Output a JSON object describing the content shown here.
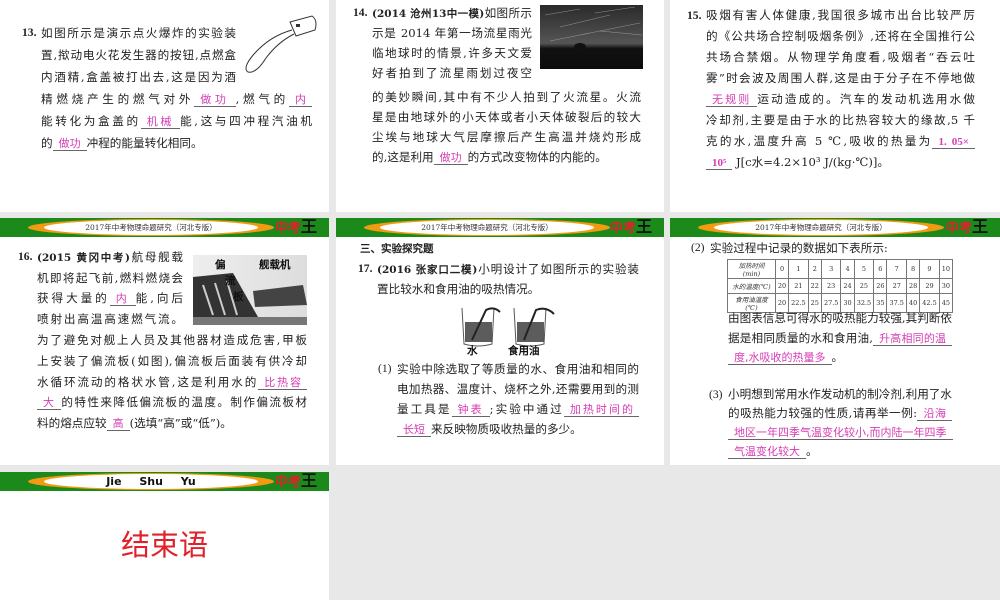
{
  "header": {
    "text": "2017年中考物理命题研究（河北专版）",
    "logo": "中考王"
  },
  "colors": {
    "answer": "#d63cb4",
    "band_green": "#1b8a1b",
    "band_orange": "#f39a12",
    "title_red": "#e0202a"
  },
  "slides": [
    {
      "id": "q13",
      "blocks": [
        [
          [
            {
              "n": "13."
            },
            "如图所示是演示点火爆炸的实验装"
          ],
          [
            "置,揿动电火花发生器的按钮,点燃盒"
          ],
          [
            "内酒精,盒盖被打出去,这是因为酒"
          ],
          [
            "精燃烧产生的燃气对外",
            {
              "a": "做功"
            },
            ",燃气的",
            {
              "a": "内"
            }
          ],
          [
            "能转化为盒盖的",
            {
              "a": "机械"
            },
            "能,这与四冲程汽油机"
          ],
          [
            "的",
            {
              "a": "做功"
            },
            "冲程的能量转化相同。"
          ]
        ]
      ]
    },
    {
      "id": "q14",
      "blocks": [
        [
          [
            {
              "n": "14."
            },
            {
              "b": "(2014 沧州13中一模)"
            },
            "如图所示"
          ],
          [
            "示是 2014 年第一场流星雨光"
          ],
          [
            "临地球时的情景,许多天文爱"
          ],
          [
            "好者拍到了流星雨划过夜空"
          ],
          [
            "的美妙瞬间,其中有不少人拍到了火流星。火流"
          ],
          [
            "星是由地球外的小天体或者小天体破裂后的较大"
          ],
          [
            "尘埃与地球大气层摩擦后产生高温并烧灼形成"
          ],
          [
            "的,这是利用",
            {
              "a": "做功"
            },
            "的方式改变物体的内能的。"
          ]
        ]
      ]
    },
    {
      "id": "q15",
      "blocks": [
        [
          [
            {
              "n": "15."
            },
            "吸烟有害人体健康,我国很多城市出台比较严厉"
          ],
          [
            "的《公共场合控制吸烟条例》,还将在全国推行公"
          ],
          [
            "共场合禁烟。从物理学角度看,吸烟者“吞云吐"
          ],
          [
            "雾”时会波及周围人群,这是由于分子在不停地做"
          ],
          [
            {
              "a": "无规则"
            },
            "运动造成的。汽车的发动机选用水做"
          ],
          [
            "冷却剂,主要是由于水的比热容较大的缘故,5 千"
          ],
          [
            "克的水,温度升高 5 ℃,吸收的热量为",
            {
              "ab": "1. 05×"
            }
          ],
          [
            {
              "ab": "10⁵"
            },
            " J[c水=4.2×10³ J/(kg·℃)]。"
          ]
        ]
      ]
    },
    {
      "id": "q16",
      "image_labels": [
        "偏",
        "流",
        "板",
        "舰载机"
      ],
      "blocks": [
        [
          [
            {
              "n": "16."
            },
            {
              "b": "(2015 黄冈中考)"
            },
            "航母舰载"
          ],
          [
            "机即将起飞前,燃料燃烧会"
          ],
          [
            "获得大量的",
            {
              "a": "内"
            },
            "能,向后"
          ],
          [
            "喷射出高温高速燃气流。"
          ],
          [
            "为了避免对舰上人员及其他器材造成危害,甲板"
          ],
          [
            "上安装了偏流板(如图),偏流板后面装有供冷却"
          ],
          [
            "水循环流动的格状水管,这是利用水的",
            {
              "a": "比热容"
            }
          ],
          [
            {
              "a": "大"
            },
            "的特性来降低偏流板的温度。制作偏流板材"
          ],
          [
            "料的熔点应较",
            {
              "a": "高"
            },
            "(选填“高”或“低”)。"
          ]
        ]
      ]
    },
    {
      "id": "q17",
      "image_labels": [
        "水",
        "食用油"
      ],
      "blocks": [
        [
          [
            {
              "b": "三、实验探究题"
            }
          ]
        ],
        [
          [
            {
              "n": "17."
            },
            {
              "b": "(2016 张家口二模)"
            },
            "小明设计了如图所示的实验装"
          ],
          [
            "置比较水和食用油的吸热情况。"
          ]
        ],
        [
          [
            {
              "p": "(1)"
            },
            "实验中除选取了等质量的水、食用油和相同的"
          ],
          [
            "电加热器、温度计、烧杯之外,还需要用到的测"
          ],
          [
            "量工具是",
            {
              "a": "钟表"
            },
            ";实验中通过",
            {
              "a": "加热时间的"
            }
          ],
          [
            {
              "a": "长短"
            },
            "来反映物质吸收热量的多少。"
          ]
        ]
      ]
    },
    {
      "id": "q17b",
      "table": {
        "rows": [
          {
            "label": "加热时间(min)",
            "values": [
              "0",
              "1",
              "2",
              "3",
              "4",
              "5",
              "6",
              "7",
              "8",
              "9",
              "10"
            ]
          },
          {
            "label": "水的温度(℃)",
            "values": [
              "20",
              "21",
              "22",
              "23",
              "24",
              "25",
              "26",
              "27",
              "28",
              "29",
              "30"
            ]
          },
          {
            "label": "食用油温度(℃)",
            "values": [
              "20",
              "22.5",
              "25",
              "27.5",
              "30",
              "32.5",
              "35",
              "37.5",
              "40",
              "42.5",
              "45"
            ]
          }
        ]
      },
      "blocks": [
        [
          [
            {
              "p": "(2)"
            },
            "实验过程中记录的数据如下表所示:"
          ]
        ],
        [
          [
            "由图表信息可得水的吸热能力较强,其判断依"
          ],
          [
            "据是相同质量的水和食用油,",
            {
              "a": "升高相同的温"
            }
          ],
          [
            {
              "a": "度,水吸收的热量多"
            },
            "。"
          ]
        ],
        [
          [
            {
              "p": "(3)"
            },
            "小明想到常用水作发动机的制冷剂,利用了水"
          ],
          [
            "的吸热能力较强的性质,请再举一例:",
            {
              "a": "沿海"
            }
          ],
          [
            {
              "a": "地区一年四季气温变化较小,而内陆一年四季"
            }
          ],
          [
            {
              "a": "气温变化较大"
            },
            "。"
          ]
        ]
      ]
    },
    {
      "id": "ending",
      "header_pinyin": "Jie Shu Yu",
      "title": "结束语"
    }
  ]
}
